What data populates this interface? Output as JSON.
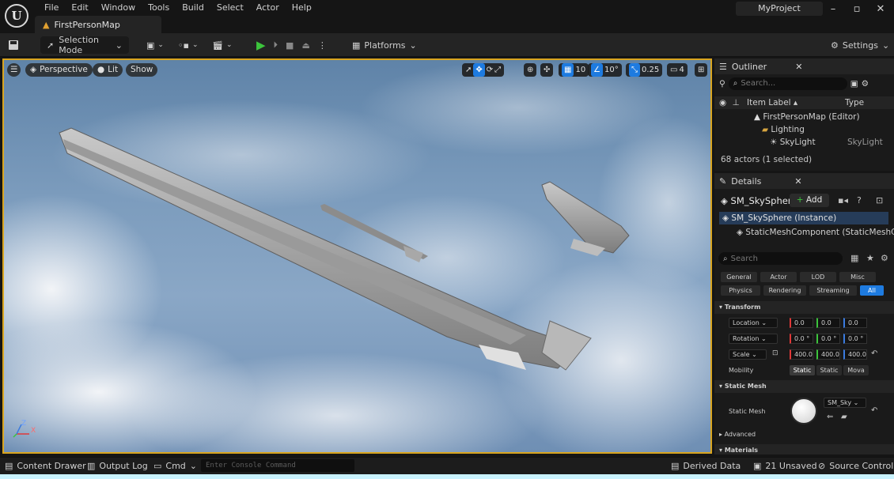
{
  "app": {
    "logo_text": "U",
    "project": "MyProject",
    "map_tab": "FirstPersonMap"
  },
  "menu": [
    "File",
    "Edit",
    "Window",
    "Tools",
    "Build",
    "Select",
    "Actor",
    "Help"
  ],
  "toolbar": {
    "selection_mode": "Selection Mode",
    "platforms": "Platforms",
    "settings": "Settings"
  },
  "viewport": {
    "perspective": "Perspective",
    "lit": "Lit",
    "show": "Show",
    "grid_snap": "10",
    "rotation_snap": "10°",
    "scale_snap": "0.25",
    "camera_speed": "4",
    "axis_z": "Z",
    "axis_x": "X"
  },
  "outliner": {
    "title": "Outliner",
    "search_placeholder": "Search...",
    "col_label": "Item Label ▴",
    "col_type": "Type",
    "items": [
      {
        "label": "FirstPersonMap (Editor)",
        "type": ""
      },
      {
        "label": "Lighting",
        "type": ""
      },
      {
        "label": "SkyLight",
        "type": "SkyLight"
      }
    ],
    "footer": "68 actors (1 selected)"
  },
  "details": {
    "title": "Details",
    "actor_name": "SM_SkySphere",
    "add_label": "Add",
    "components": [
      "SM_SkySphere (Instance)",
      "StaticMeshComponent (StaticMeshCo"
    ],
    "search_placeholder": "Search",
    "filters_row1": [
      "General",
      "Actor",
      "LOD",
      "Misc"
    ],
    "filters_row2": [
      "Physics",
      "Rendering",
      "Streaming",
      "All"
    ],
    "transform": {
      "section": "Transform",
      "location_label": "Location",
      "location": [
        "0.0",
        "0.0",
        "0.0"
      ],
      "rotation_label": "Rotation",
      "rotation": [
        "0.0 °",
        "0.0 °",
        "0.0 °"
      ],
      "scale_label": "Scale",
      "scale": [
        "400.0",
        "400.0",
        "400.0"
      ],
      "mobility_label": "Mobility",
      "mobility": [
        "Static",
        "Static",
        "Mova"
      ]
    },
    "static_mesh": {
      "section": "Static Mesh",
      "label": "Static Mesh",
      "asset": "SM_Sky"
    },
    "advanced": "Advanced",
    "materials": "Materials"
  },
  "statusbar": {
    "content_drawer": "Content Drawer",
    "output_log": "Output Log",
    "cmd": "Cmd",
    "console_placeholder": "Enter Console Command",
    "derived_data": "Derived Data",
    "unsaved": "21 Unsaved",
    "source_control": "Source Control"
  },
  "colors": {
    "accent": "#1e7be0",
    "viewport_border": "#d9a51f",
    "play": "#3cc43c"
  }
}
